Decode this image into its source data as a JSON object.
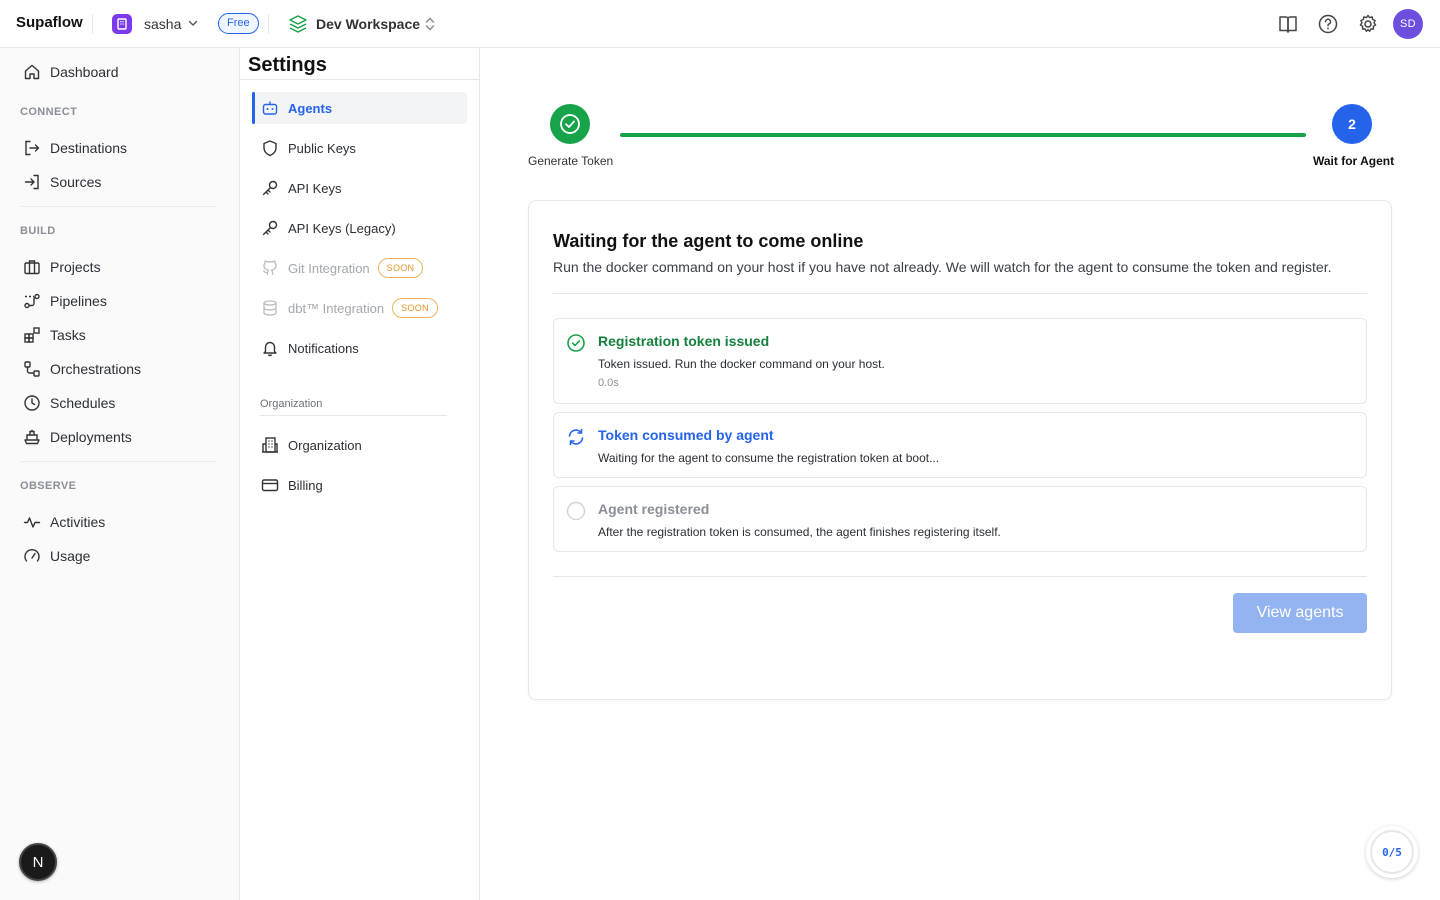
{
  "topbar": {
    "brand": "Supaflow",
    "org_name": "sasha",
    "plan_badge": "Free",
    "workspace_name": "Dev Workspace",
    "avatar_initials": "SD",
    "icons": [
      "docs-book-icon",
      "help-icon",
      "settings-gear-icon"
    ]
  },
  "sidebar": {
    "dashboard": "Dashboard",
    "sections": {
      "connect": "CONNECT",
      "build": "BUILD",
      "observe": "OBSERVE"
    },
    "connect_items": [
      "Destinations",
      "Sources"
    ],
    "build_items": [
      "Projects",
      "Pipelines",
      "Tasks",
      "Orchestrations",
      "Schedules",
      "Deployments"
    ],
    "observe_items": [
      "Activities",
      "Usage"
    ],
    "bottom_badge": "N"
  },
  "settings": {
    "title": "Settings",
    "items": [
      {
        "label": "Agents",
        "active": true
      },
      {
        "label": "Public Keys"
      },
      {
        "label": "API Keys"
      },
      {
        "label": "API Keys (Legacy)"
      },
      {
        "label": "Git Integration",
        "disabled": true,
        "badge": "SOON"
      },
      {
        "label": "dbt™ Integration",
        "disabled": true,
        "badge": "SOON"
      },
      {
        "label": "Notifications"
      }
    ],
    "org_section_label": "Organization",
    "org_items": [
      "Organization",
      "Billing"
    ]
  },
  "stepper": {
    "step1_label": "Generate Token",
    "step2_number": "2",
    "step2_label": "Wait for Agent",
    "colors": {
      "done": "#16a34a",
      "current": "#2563eb"
    }
  },
  "card": {
    "title": "Waiting for the agent to come online",
    "subtitle": "Run the docker command on your host if you have not already. We will watch for the agent to consume the token and register.",
    "statuses": [
      {
        "title": "Registration token issued",
        "desc": "Token issued. Run the docker command on your host.",
        "meta": "0.0s",
        "state": "done"
      },
      {
        "title": "Token consumed by agent",
        "desc": "Waiting for the agent to consume the registration token at boot...",
        "state": "in-progress"
      },
      {
        "title": "Agent registered",
        "desc": "After the registration token is consumed, the agent finishes registering itself.",
        "state": "pending"
      }
    ],
    "view_button": "View agents"
  },
  "progress_widget": {
    "text": "0/5"
  }
}
